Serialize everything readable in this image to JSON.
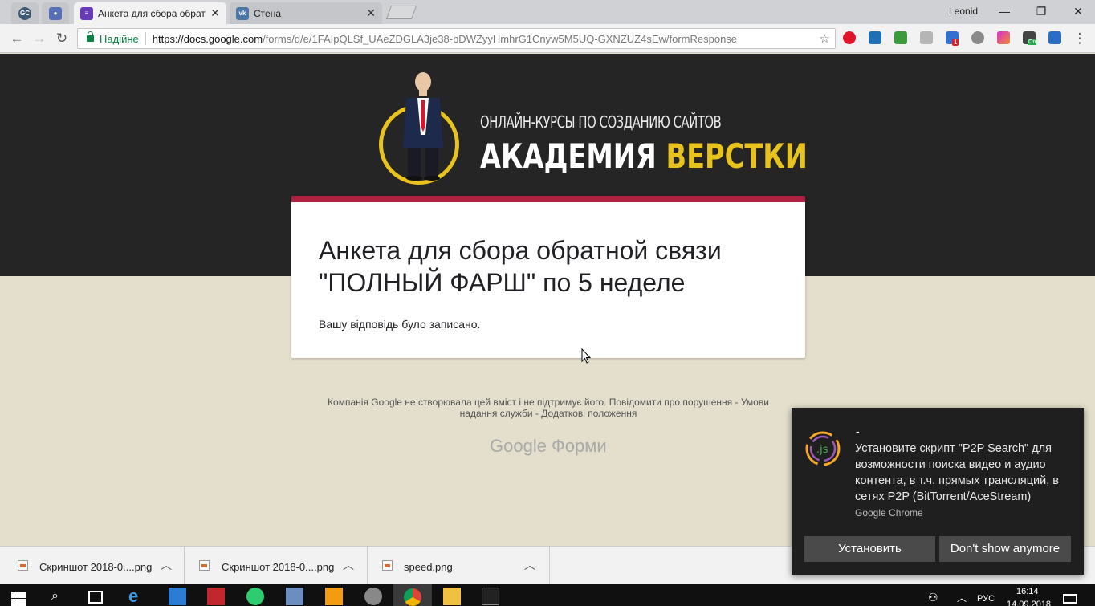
{
  "browser": {
    "tabs": [
      {
        "label": "",
        "favicon": "gc-icon"
      },
      {
        "label": "",
        "favicon": "screen-record-icon"
      },
      {
        "label": "Анкета для сбора обрат",
        "favicon": "google-forms-icon",
        "active": true
      },
      {
        "label": "Стена",
        "favicon": "vk-icon"
      }
    ],
    "user": "Leonid",
    "secure_label": "Надійне",
    "url_host": "https://docs.google.com",
    "url_path": "/forms/d/e/1FAIpQLSf_UAeZDGLA3je38-bDWZyyHmhrG1Cnyw5M5UQ-GXNZUZ4sEw/formResponse",
    "extension_badge": "1",
    "extension_on_label": "On"
  },
  "logo": {
    "subtitle": "ОНЛАЙН-КУРСЫ ПО СОЗДАНИЮ САЙТОВ",
    "main_part1": "АКАДЕМИЯ",
    "main_part2": "ВЕРСТКИ"
  },
  "form": {
    "title": "Анкета для сбора обратной связи \"ПОЛНЫЙ ФАРШ\" по 5 неделе",
    "response_message": "Вашу відповідь було записано."
  },
  "footer": {
    "text_line1": "Компанія Google не створювала цей вміст і не підтримує його. Повідомити про порушення - Умови",
    "text_line2": "надання служби - Додаткові положення",
    "brand": "Google Форми"
  },
  "downloads": [
    {
      "name": "Скриншот 2018-0....png"
    },
    {
      "name": "Скриншот 2018-0....png"
    },
    {
      "name": "speed.png"
    }
  ],
  "notification": {
    "title": "-",
    "body": "Установите скрипт \"P2P Search\" для возможности поиска видео и аудио контента, в т.ч. прямых трансляций, в сетях P2P (BitTorrent/AceStream)",
    "source": "Google Chrome",
    "install_label": "Установить",
    "dismiss_label": "Don't show anymore"
  },
  "taskbar": {
    "language": "РУС",
    "time": "16:14",
    "date": "14.09.2018"
  },
  "colors": {
    "header_bg": "#252525",
    "page_bg": "#e4dfcc",
    "accent_bar": "#b02043",
    "logo_yellow": "#e8c31d",
    "secure_green": "#0b8043"
  }
}
